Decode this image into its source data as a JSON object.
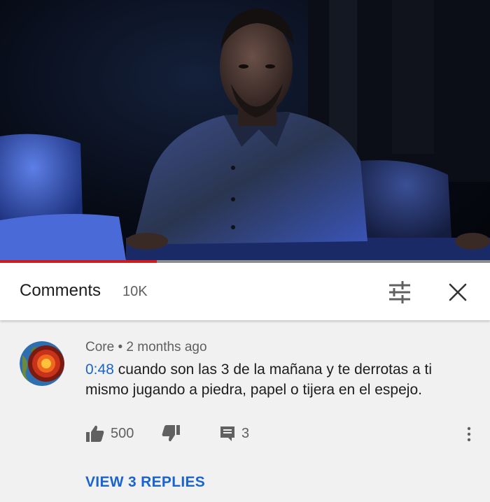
{
  "video": {
    "progress": 0.32
  },
  "comments_header": {
    "title": "Comments",
    "count": "10K",
    "sort_icon": "sort-filter-icon",
    "close_icon": "close-icon"
  },
  "comment": {
    "author": "Core",
    "separator": "•",
    "time": "2 months ago",
    "timestamp_link": "0:48",
    "text": " cuando son las 3 de la mañana y te derrotas a ti mismo jugando a piedra, papel o tijera en el espejo.",
    "likes": "500",
    "reply_count": "3",
    "view_replies": "VIEW 3 REPLIES"
  },
  "colors": {
    "accent_blue": "#1a64d0",
    "progress_red": "#d01c1c",
    "comment_bg": "#f1f1f1"
  }
}
